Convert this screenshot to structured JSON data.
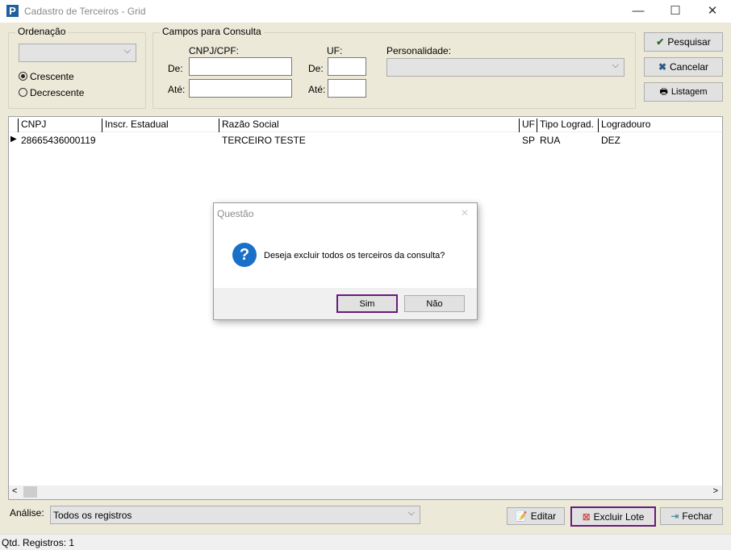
{
  "window": {
    "title": "Cadastro de Terceiros - Grid",
    "minimize": "—",
    "maximize": "☐",
    "close": "✕"
  },
  "ordenacao": {
    "label": "Ordenação",
    "combo_value": "",
    "radio_options": [
      {
        "label": "Crescente",
        "selected": true
      },
      {
        "label": "Decrescente",
        "selected": false
      }
    ]
  },
  "consulta": {
    "label": "Campos para Consulta",
    "cnpj_label": "CNPJ/CPF:",
    "uf_label": "UF:",
    "de": "De:",
    "ate": "Até:",
    "personalidade_label": "Personalidade:",
    "cnpj_de": "",
    "cnpj_ate": "",
    "uf_de": "",
    "uf_ate": "",
    "personalidade_value": ""
  },
  "buttons": {
    "pesquisar": "Pesquisar",
    "cancelar": "Cancelar",
    "listagem": "Listagem",
    "editar": "Editar",
    "excluir_lote": "Excluir Lote",
    "fechar": "Fechar"
  },
  "grid": {
    "columns": [
      "CNPJ",
      "Inscr. Estadual",
      "Razão Social",
      "UF",
      "Tipo Lograd.",
      "Logradouro"
    ],
    "rows": [
      [
        "28665436000119",
        "",
        "TERCEIRO TESTE",
        "SP",
        "RUA",
        "DEZ"
      ]
    ]
  },
  "analise": {
    "label": "Análise:",
    "value": "Todos os registros"
  },
  "status": {
    "text": "Qtd. Registros: 1"
  },
  "dialog": {
    "title": "Questão",
    "message": "Deseja excluir todos os terceiros da consulta?",
    "yes": "Sim",
    "no": "Não",
    "close": "✕",
    "icon": "?"
  }
}
